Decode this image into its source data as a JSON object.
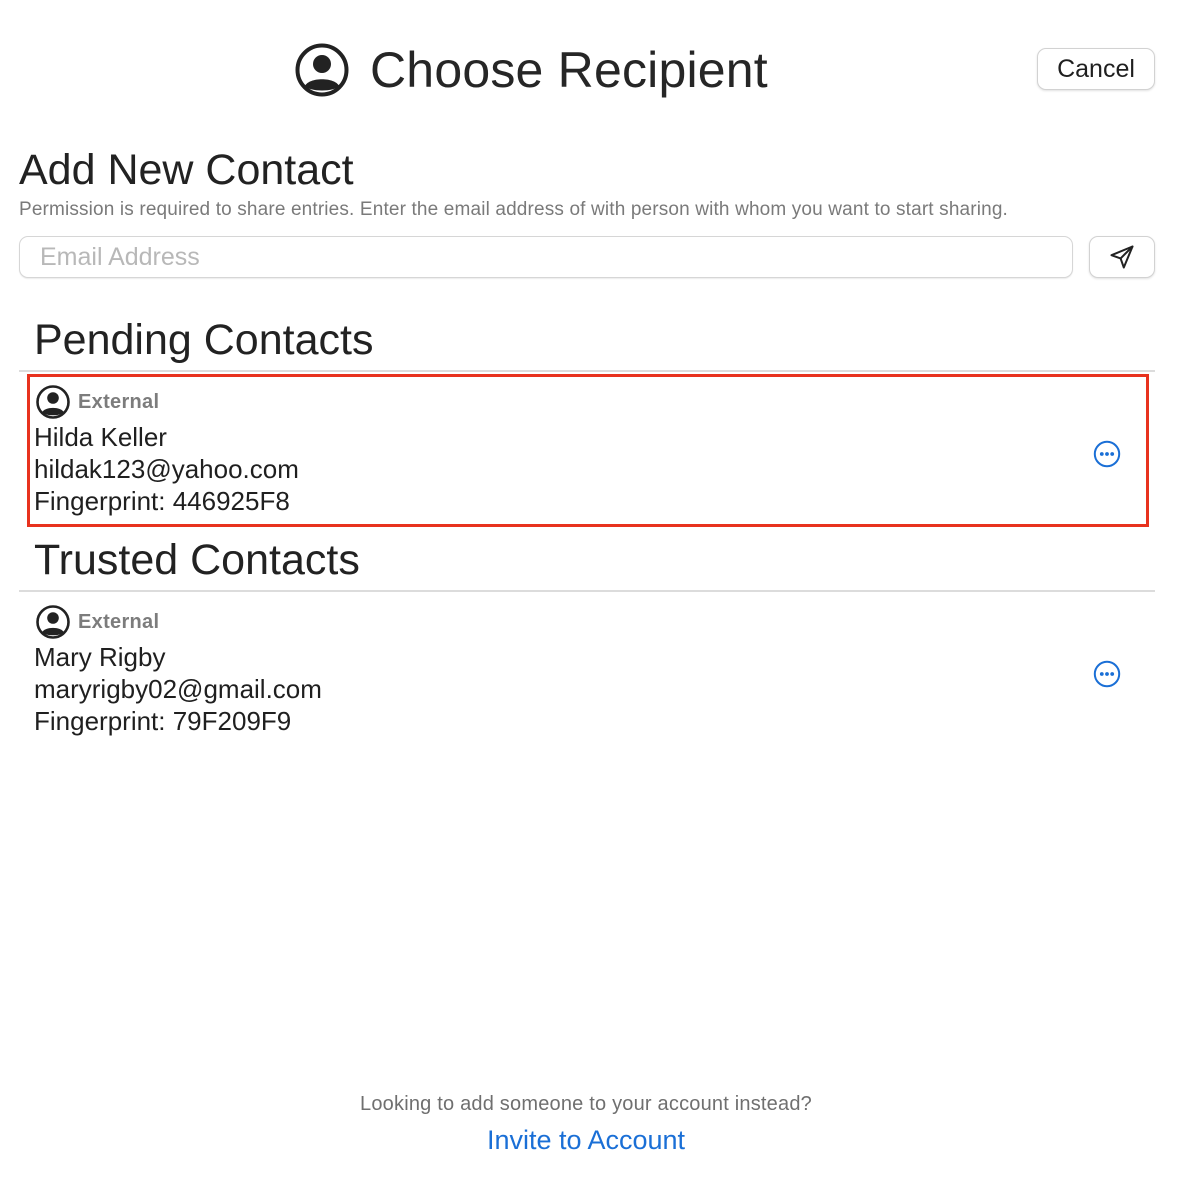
{
  "header": {
    "title": "Choose Recipient",
    "icon": "person-circle-icon",
    "cancel_label": "Cancel"
  },
  "add_contact": {
    "title": "Add New Contact",
    "description": "Permission is required to share entries. Enter the email address of with person with whom you want to start sharing.",
    "email_value": "",
    "email_placeholder": "Email Address",
    "send_icon": "paper-plane-icon"
  },
  "pending": {
    "title": "Pending Contacts",
    "contacts": [
      {
        "type": "External",
        "name": "Hilda Keller",
        "email": "hildak123@yahoo.com",
        "fingerprint": "Fingerprint: 446925F8",
        "highlighted": true
      }
    ]
  },
  "trusted": {
    "title": "Trusted Contacts",
    "contacts": [
      {
        "type": "External",
        "name": "Mary Rigby",
        "email": "maryrigby02@gmail.com",
        "fingerprint": "Fingerprint: 79F209F9"
      }
    ]
  },
  "footer": {
    "prompt": "Looking to add someone to your account instead?",
    "invite_label": "Invite to Account"
  },
  "colors": {
    "accent": "#1a6fd6",
    "highlight": "#e8321e",
    "muted_text": "#7a7a7a"
  }
}
